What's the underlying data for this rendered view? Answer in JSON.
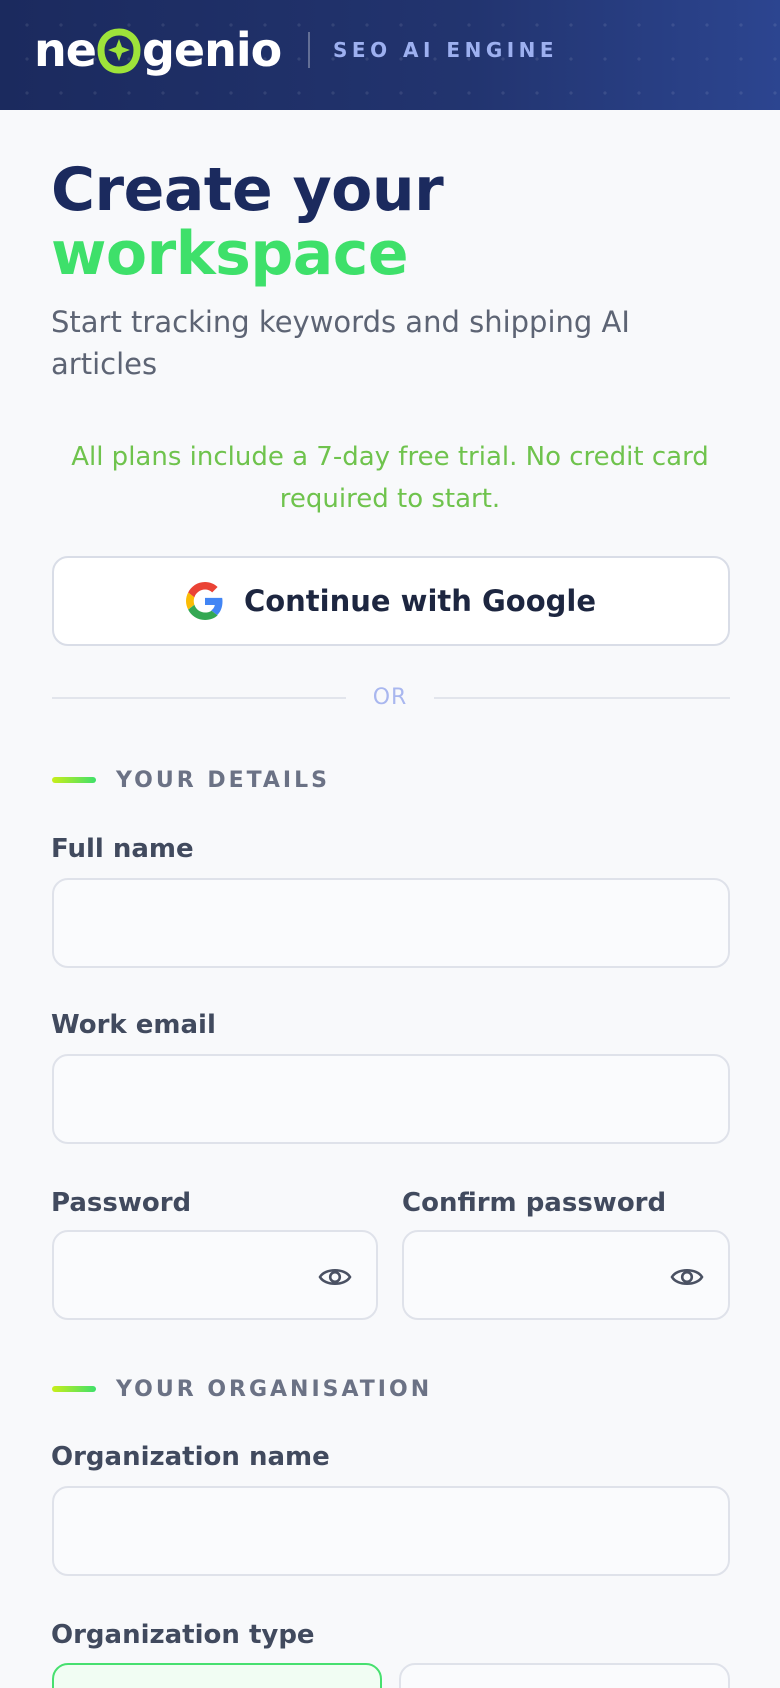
{
  "header": {
    "logo_text": "neogenio",
    "tagline": "SEO AI ENGINE"
  },
  "page": {
    "title_line1": "Create your",
    "title_line2": "workspace",
    "subtitle": "Start tracking keywords and shipping AI articles",
    "trial_note": "All plans include a 7-day free trial. No credit card required to start."
  },
  "google_button": {
    "label": "Continue with Google"
  },
  "divider": {
    "label": "OR"
  },
  "sections": {
    "details": "YOUR DETAILS",
    "organisation": "YOUR ORGANISATION"
  },
  "fields": {
    "full_name": {
      "label": "Full name",
      "value": ""
    },
    "work_email": {
      "label": "Work email",
      "value": ""
    },
    "password": {
      "label": "Password",
      "value": ""
    },
    "confirm_password": {
      "label": "Confirm password",
      "value": ""
    },
    "organization_name": {
      "label": "Organization name",
      "value": ""
    },
    "organization_type": {
      "label": "Organization type"
    }
  },
  "colors": {
    "header_bg": "#1b2a5e",
    "title_dark": "#1b2a5e",
    "accent_green": "#3ee06a",
    "trial_green": "#6fc34d",
    "tagline_blue": "#9db0f0"
  }
}
